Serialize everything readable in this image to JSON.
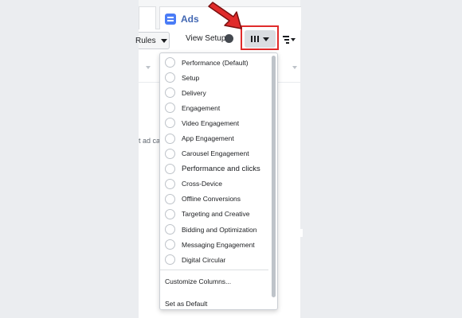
{
  "tab": {
    "label": "Ads"
  },
  "toolbar": {
    "rules_label": "Rules",
    "view_setup_label": "View Setup"
  },
  "background": {
    "partial_text": "t ad ca"
  },
  "columns_menu": {
    "presets": [
      {
        "label": "Performance (Default)"
      },
      {
        "label": "Setup"
      },
      {
        "label": "Delivery"
      },
      {
        "label": "Engagement"
      },
      {
        "label": "Video Engagement"
      },
      {
        "label": "App Engagement"
      },
      {
        "label": "Carousel Engagement"
      },
      {
        "label": "Performance and clicks"
      },
      {
        "label": "Cross-Device"
      },
      {
        "label": "Offline Conversions"
      },
      {
        "label": "Targeting and Creative"
      },
      {
        "label": "Bidding and Optimization"
      },
      {
        "label": "Messaging Engagement"
      },
      {
        "label": "Digital Circular"
      }
    ],
    "customize_label": "Customize Columns...",
    "set_default_label": "Set as Default"
  },
  "colors": {
    "annotation": "#e02b2b",
    "accent": "#4267b2"
  }
}
